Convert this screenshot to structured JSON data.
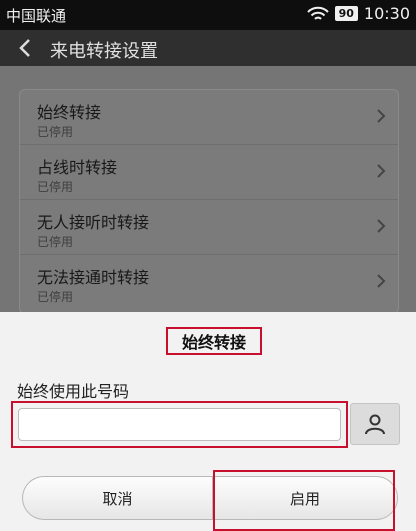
{
  "status_bar": {
    "carrier": "中国联通",
    "battery": "90",
    "time": "10:30"
  },
  "header": {
    "title": "来电转接设置"
  },
  "forward_options": [
    {
      "title": "始终转接",
      "status": "已停用"
    },
    {
      "title": "占线时转接",
      "status": "已停用"
    },
    {
      "title": "无人接听时转接",
      "status": "已停用"
    },
    {
      "title": "无法接通时转接",
      "status": "已停用"
    }
  ],
  "dialog": {
    "title": "始终转接",
    "label": "始终使用此号码",
    "number_value": "",
    "cancel": "取消",
    "enable": "启用"
  },
  "colors": {
    "highlight_frame": "#c8102e"
  }
}
